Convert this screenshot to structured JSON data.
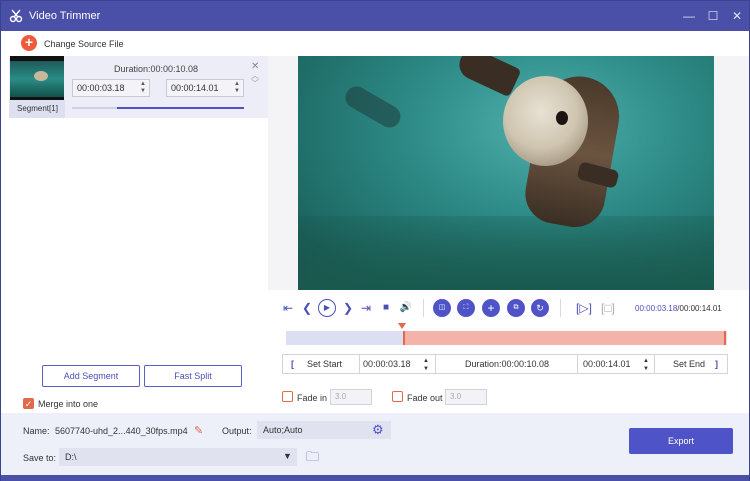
{
  "window": {
    "title": "Video Trimmer",
    "minimize": "—",
    "maximize": "☐",
    "close": "✕"
  },
  "toolbar": {
    "change_source": "Change Source File"
  },
  "segment": {
    "label": "Segment[1]",
    "duration": "Duration:00:00:10.08",
    "start": "00:00:03.18",
    "end": "00:00:14.01"
  },
  "left_buttons": {
    "add_segment": "Add Segment",
    "fast_split": "Fast Split"
  },
  "merge": {
    "label": "Merge into one",
    "checked": true
  },
  "player": {
    "current": "00:00:03.18",
    "total": "/00:00:14.01"
  },
  "trim": {
    "set_start": "Set Start",
    "start_value": "00:00:03.18",
    "duration": "Duration:00:00:10.08",
    "end_value": "00:00:14.01",
    "set_end": "Set End",
    "open_bracket": "[",
    "close_bracket": "]"
  },
  "fade": {
    "in_label": "Fade in",
    "in_value": "3.0",
    "out_label": "Fade out",
    "out_value": "3.0"
  },
  "output": {
    "name_label": "Name:",
    "name_value": "5607740-uhd_2...440_30fps.mp4",
    "output_label": "Output:",
    "output_value": "Auto;Auto",
    "save_label": "Save to:",
    "save_value": "D:\\",
    "export": "Export"
  },
  "colors": {
    "accent": "#4e54c8",
    "orange": "#e06a4a",
    "titlebar": "#4a4fa8"
  }
}
